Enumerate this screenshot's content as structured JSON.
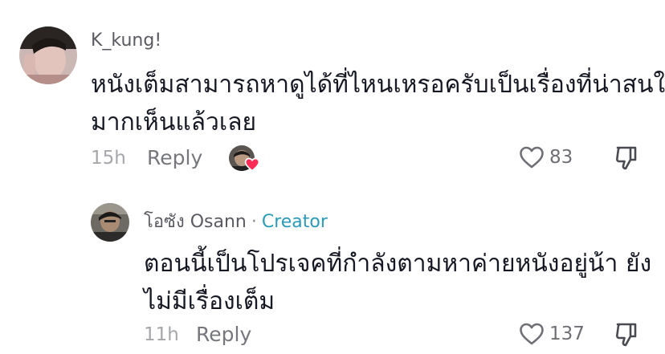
{
  "comment": {
    "username": "K_kung!",
    "text_line1": "หนังเต็มสามารถหาดูได้ที่ไหนเหรอครับเป็นเรื่องที่น่าสนใจ",
    "text_line2": "มากเห็นแล้วเลย",
    "timestamp": "15h",
    "reply_label": "Reply",
    "like_count": "83",
    "avatar_icon": "user-avatar",
    "liked_by_icon": "creator-liked-avatar"
  },
  "reply": {
    "username": "โอซัง Osann",
    "separator": "·",
    "creator_label": "Creator",
    "text_line1": "ตอนนี้เป็นโปรเจคที่กำลังตามหาค่ายหนังอยู่น้า ยัง",
    "text_line2": "ไม่มีเรื่องเต็ม",
    "timestamp": "11h",
    "reply_label": "Reply",
    "like_count": "137",
    "avatar_icon": "creator-avatar"
  },
  "icons": {
    "like": "heart-outline-icon",
    "dislike": "thumbs-down-icon",
    "liked_heart": "heart-filled-icon"
  },
  "colors": {
    "creator_accent": "#2a9bb8",
    "heart_red": "#fe2c55",
    "text_primary": "#161823",
    "text_secondary": "#5a5b62",
    "text_muted": "#a6a7ab"
  }
}
